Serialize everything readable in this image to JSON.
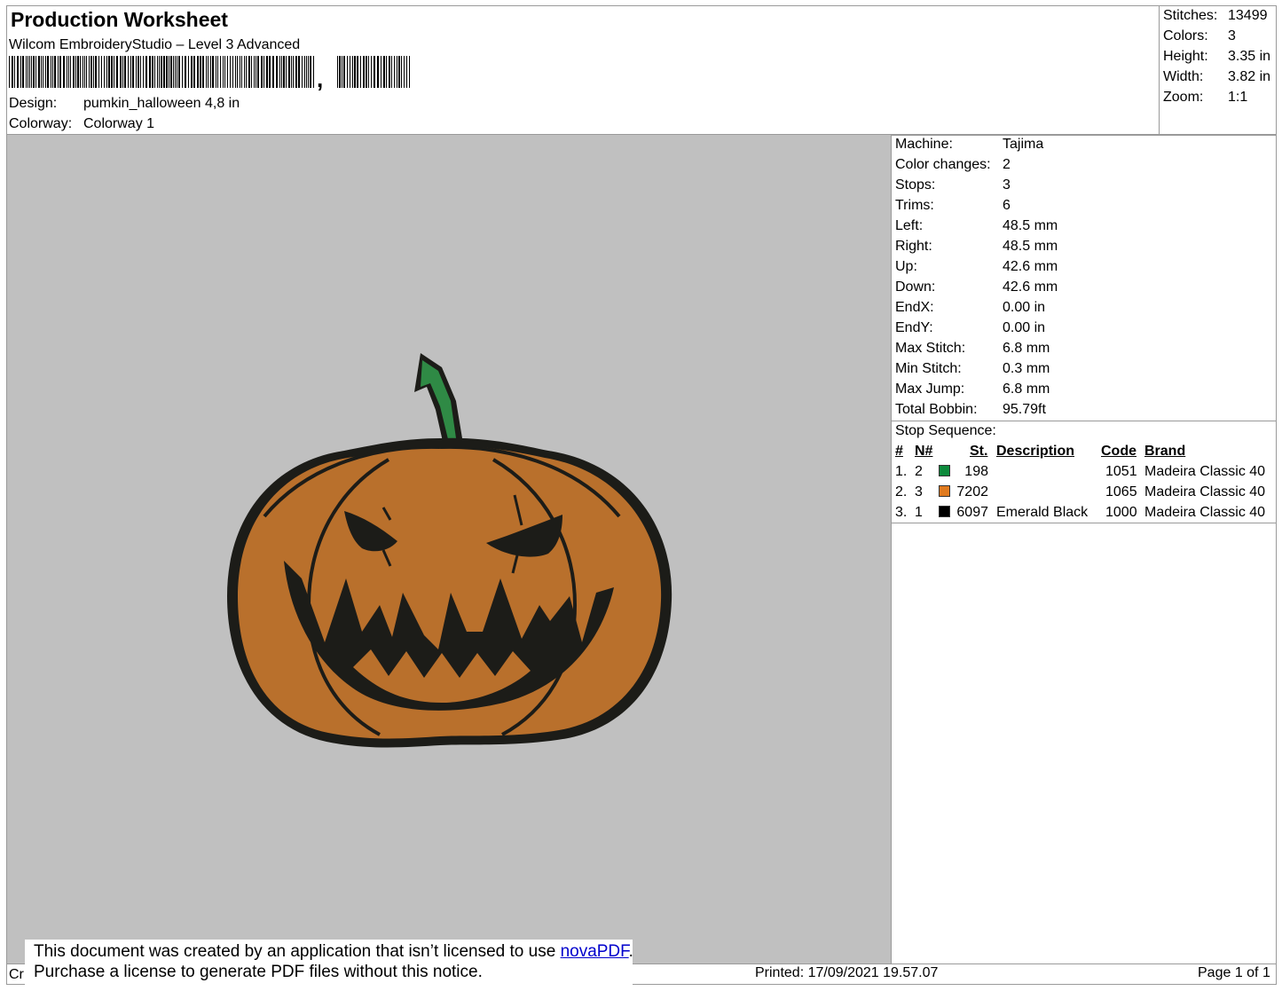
{
  "header": {
    "title": "Production Worksheet",
    "software": "Wilcom EmbroideryStudio – Level 3 Advanced",
    "barcode_suffix": ",",
    "design_label": "Design:",
    "design_value": "pumkin_halloween 4,8 in",
    "colorway_label": "Colorway:",
    "colorway_value": "Colorway 1"
  },
  "summary": [
    {
      "label": "Stitches:",
      "value": "13499"
    },
    {
      "label": "Colors:",
      "value": "3"
    },
    {
      "label": "Height:",
      "value": "3.35 in"
    },
    {
      "label": "Width:",
      "value": "3.82 in"
    },
    {
      "label": "Zoom:",
      "value": "1:1"
    }
  ],
  "details": [
    {
      "label": "Machine:",
      "value": "Tajima"
    },
    {
      "label": "Color changes:",
      "value": "2"
    },
    {
      "label": "Stops:",
      "value": "3"
    },
    {
      "label": "Trims:",
      "value": "6"
    },
    {
      "label": "Left:",
      "value": "48.5 mm"
    },
    {
      "label": "Right:",
      "value": "48.5 mm"
    },
    {
      "label": "Up:",
      "value": "42.6 mm"
    },
    {
      "label": "Down:",
      "value": "42.6 mm"
    },
    {
      "label": "EndX:",
      "value": "0.00 in"
    },
    {
      "label": "EndY:",
      "value": "0.00 in"
    },
    {
      "label": "Max Stitch:",
      "value": "6.8 mm"
    },
    {
      "label": "Min Stitch:",
      "value": "0.3 mm"
    },
    {
      "label": "Max Jump:",
      "value": "6.8 mm"
    },
    {
      "label": "Total Bobbin:",
      "value": "95.79ft"
    }
  ],
  "stop_sequence": {
    "title": "Stop Sequence:",
    "headers": {
      "num": "#",
      "n": "N#",
      "st": "St.",
      "desc": "Description",
      "code": "Code",
      "brand": "Brand"
    },
    "rows": [
      {
        "num": "1.",
        "n": "2",
        "color": "#0e8a3c",
        "st": "198",
        "desc": "",
        "code": "1051",
        "brand": "Madeira Classic 40"
      },
      {
        "num": "2.",
        "n": "3",
        "color": "#e07a1e",
        "st": "7202",
        "desc": "",
        "code": "1065",
        "brand": "Madeira Classic 40"
      },
      {
        "num": "3.",
        "n": "1",
        "color": "#000000",
        "st": "6097",
        "desc": "Emerald Black",
        "code": "1000",
        "brand": "Madeira Classic 40"
      }
    ]
  },
  "design_preview": {
    "background": "#c0c0c0",
    "thread_colors": {
      "stem": "#2f8a45",
      "pumpkin": "#b9702c",
      "outline": "#1c1c18"
    }
  },
  "footer": {
    "created_prefix": "Cr",
    "notice_line1_prefix": "This document was created by an application that isn’t licensed to use ",
    "notice_link": "novaPDF",
    "notice_line1_suffix": ".",
    "notice_line2": "Purchase a license to generate PDF files without this notice.",
    "printed": "Printed: 17/09/2021 19.57.07",
    "page": "Page 1 of 1"
  }
}
